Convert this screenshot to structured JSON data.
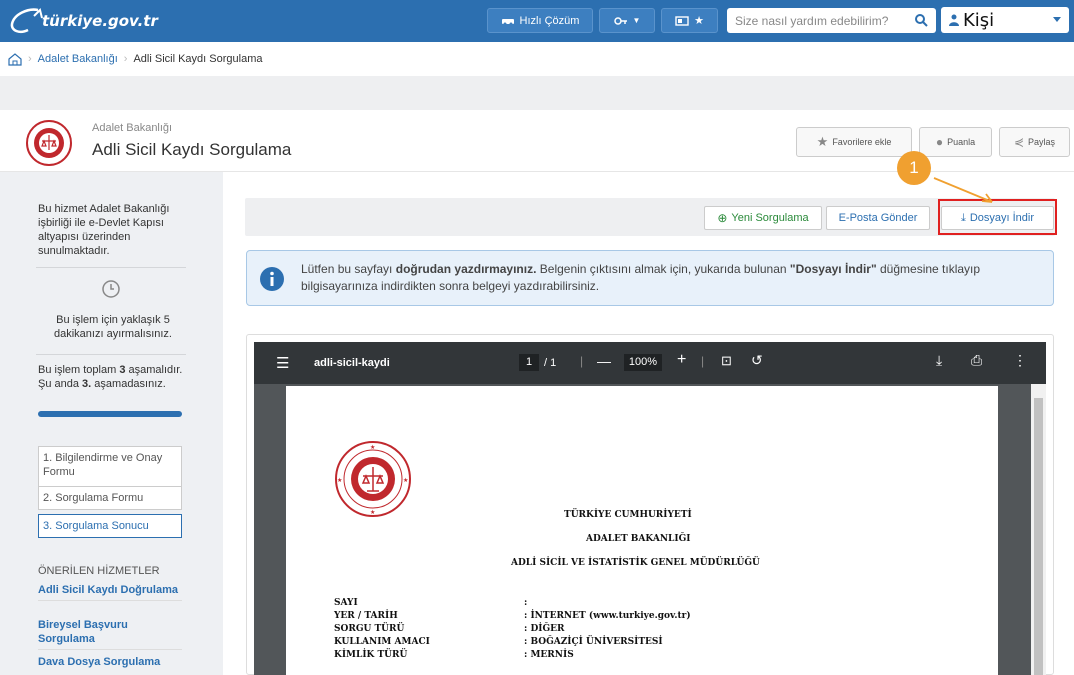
{
  "topbar": {
    "logo_text": "türkiye.gov.tr",
    "quick_solution": "Hızlı Çözüm",
    "search_placeholder": "Size nasıl yardım edebilirim?",
    "user_name": "Kişi"
  },
  "breadcrumb": {
    "items": [
      "Adalet Bakanlığı",
      "Adli Sicil Kaydı Sorgulama"
    ]
  },
  "header": {
    "institution": "Adalet Bakanlığı",
    "title": "Adli Sicil Kaydı Sorgulama",
    "favorite": "Favorilere ekle",
    "rate": "Puanla",
    "share": "Paylaş"
  },
  "sidebar": {
    "info": "Bu hizmet Adalet Bakanlığı işbirliği ile e-Devlet Kapısı altyapısı üzerinden sunulmaktadır.",
    "time": "Bu işlem için yaklaşık 5 dakikanızı ayırmalısınız.",
    "steps_text_a": "Bu işlem toplam",
    "steps_total": "3",
    "steps_text_b": "aşamalıdır. Şu anda",
    "steps_current": "3.",
    "steps_text_c": "aşamadasınız.",
    "progress": 1.0,
    "steps": [
      "1. Bilgilendirme ve Onay Formu",
      "2. Sorgulama Formu",
      "3. Sorgulama Sonucu"
    ],
    "suggested_title": "ÖNERİLEN HİZMETLER",
    "suggested": [
      "Adli Sicil Kaydı Doğrulama",
      "Bireysel Başvuru Sorgulama",
      "Dava Dosya Sorgulama"
    ]
  },
  "actions": {
    "new_query": "Yeni Sorgulama",
    "email": "E-Posta Gönder",
    "download": "Dosyayı İndir"
  },
  "annotation": {
    "badge": "1"
  },
  "info": {
    "part1": "Lütfen bu sayfayı ",
    "bold1": "doğrudan yazdırmayınız.",
    "part2": " Belgenin çıktısını almak için, yukarıda bulunan ",
    "bold2": "\"Dosyayı İndir\"",
    "part3": " düğmesine tıklayıp bilgisayarınıza indirdikten sonra belgeyi yazdırabilirsiniz."
  },
  "pdf": {
    "filename": "adli-sicil-kaydi",
    "page": "1",
    "pages": "/ 1",
    "zoom": "100%",
    "doc": {
      "line1": "TÜRKİYE CUMHURİYETİ",
      "line2": "ADALET BAKANLIĞI",
      "line3": "ADLİ SİCİL VE İSTATİSTİK GENEL MÜDÜRLÜĞÜ",
      "fields": [
        {
          "label": "SAYI",
          "value": ":"
        },
        {
          "label": "YER / TARİH",
          "value": ": İNTERNET (www.turkiye.gov.tr)"
        },
        {
          "label": "SORGU TÜRÜ",
          "value": ": DİĞER"
        },
        {
          "label": "KULLANIM AMACI",
          "value": ": BOĞAZİÇİ ÜNİVERSİTESİ"
        },
        {
          "label": "KİMLİK TÜRÜ",
          "value": ": MERNİS"
        }
      ]
    }
  }
}
